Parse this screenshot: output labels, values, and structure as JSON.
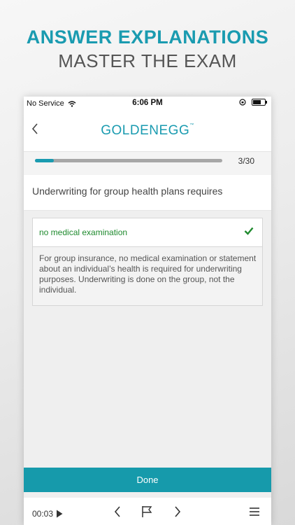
{
  "promo": {
    "title": "ANSWER EXPLANATIONS",
    "subtitle": "MASTER THE EXAM"
  },
  "status_bar": {
    "carrier": "No Service",
    "time": "6:06 PM",
    "icons": [
      "wifi-icon",
      "orientation-lock-icon",
      "battery-icon"
    ]
  },
  "nav": {
    "back_icon": "chevron-left-icon",
    "logo_text": "GOLDENEGG",
    "logo_tm": "™"
  },
  "progress": {
    "current": 3,
    "total": 30,
    "label": "3/30",
    "fraction": 0.1,
    "color": "#1a9bb0"
  },
  "question": {
    "text": "Underwriting for group health plans requires"
  },
  "answer": {
    "text": "no medical examination",
    "status": "correct",
    "status_icon": "checkmark-icon",
    "color": "#1f8a2e",
    "explanation": "For group insurance, no medical examination or statement about an individual’s health is required for underwriting purposes. Underwriting is done on the group, not the individual."
  },
  "done_button": {
    "label": "Done",
    "color": "#169aab"
  },
  "toolbar": {
    "timer": "00:03",
    "icons": [
      "play-icon",
      "previous-icon",
      "flag-icon",
      "next-icon",
      "menu-icon"
    ]
  }
}
